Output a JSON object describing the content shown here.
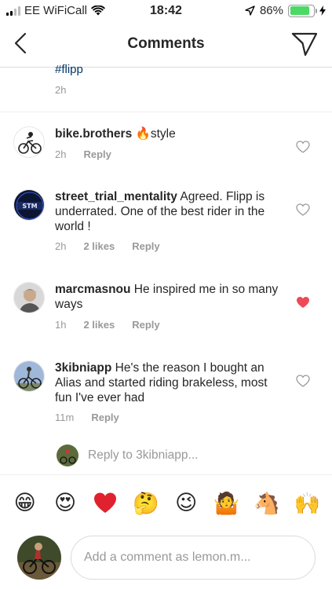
{
  "status_bar": {
    "carrier": "EE WiFiCall",
    "time": "18:42",
    "battery_percent": "86%",
    "battery_level": 0.86,
    "accent_color": "#4cd964"
  },
  "nav": {
    "title": "Comments",
    "back_icon": "chevron-left-icon",
    "send_icon": "paper-plane-icon"
  },
  "caption": {
    "tail_text": "#flipp",
    "time": "2h"
  },
  "comments": [
    {
      "username": "bike.brothers",
      "text": "🔥style",
      "time": "2h",
      "likes": "",
      "reply_label": "Reply",
      "liked": false
    },
    {
      "username": "street_trial_mentality",
      "text": "Agreed. Flipp is underrated. One of the best rider in the world !",
      "time": "2h",
      "likes": "2 likes",
      "reply_label": "Reply",
      "liked": false
    },
    {
      "username": "marcmasnou",
      "text": "He inspired me in so many ways",
      "time": "1h",
      "likes": "2 likes",
      "reply_label": "Reply",
      "liked": true
    },
    {
      "username": "3kibniapp",
      "text": "He's the reason I bought an Alias and started riding brakeless, most fun I've ever had",
      "time": "11m",
      "likes": "",
      "reply_label": "Reply",
      "liked": false
    }
  ],
  "reply_to": {
    "label": "Reply to 3kibniapp..."
  },
  "emoji_bar": [
    "😁",
    "😍",
    "❤",
    "🤔",
    "😉",
    "🤷",
    "🐴",
    "🙌"
  ],
  "input": {
    "placeholder": "Add a comment as lemon.m..."
  },
  "colors": {
    "liked_heart": "#ed4956",
    "link_blue": "#003569",
    "muted": "#999999"
  }
}
